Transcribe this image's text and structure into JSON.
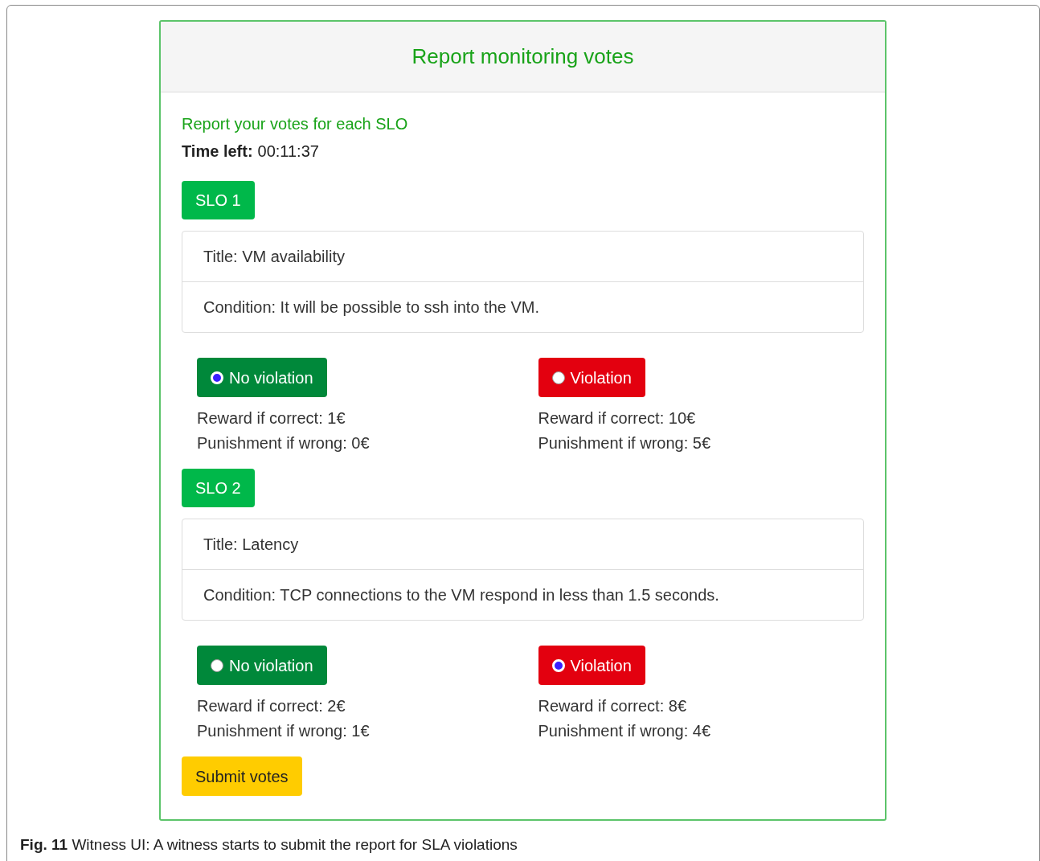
{
  "card": {
    "title": "Report monitoring votes",
    "subtitle": "Report your votes for each SLO",
    "time_label": "Time left:",
    "time_value": "00:11:37"
  },
  "slos": [
    {
      "label": "SLO 1",
      "title": "Title: VM availability",
      "condition": "Condition: It will be possible to ssh into the VM.",
      "options": [
        {
          "kind": "no_violation",
          "label": "No violation",
          "selected": true,
          "reward": "Reward if correct: 1€",
          "punishment": "Punishment if wrong: 0€"
        },
        {
          "kind": "violation",
          "label": "Violation",
          "selected": false,
          "reward": "Reward if correct: 10€",
          "punishment": "Punishment if wrong: 5€"
        }
      ]
    },
    {
      "label": "SLO 2",
      "title": "Title: Latency",
      "condition": "Condition: TCP connections to the VM respond in less than 1.5 seconds.",
      "options": [
        {
          "kind": "no_violation",
          "label": "No violation",
          "selected": false,
          "reward": "Reward if correct: 2€",
          "punishment": "Punishment if wrong: 1€"
        },
        {
          "kind": "violation",
          "label": "Violation",
          "selected": true,
          "reward": "Reward if correct: 8€",
          "punishment": "Punishment if wrong: 4€"
        }
      ]
    }
  ],
  "submit": "Submit votes",
  "caption": "**Fig. 11** Witness UI: A witness starts to submit the report for SLA violations"
}
